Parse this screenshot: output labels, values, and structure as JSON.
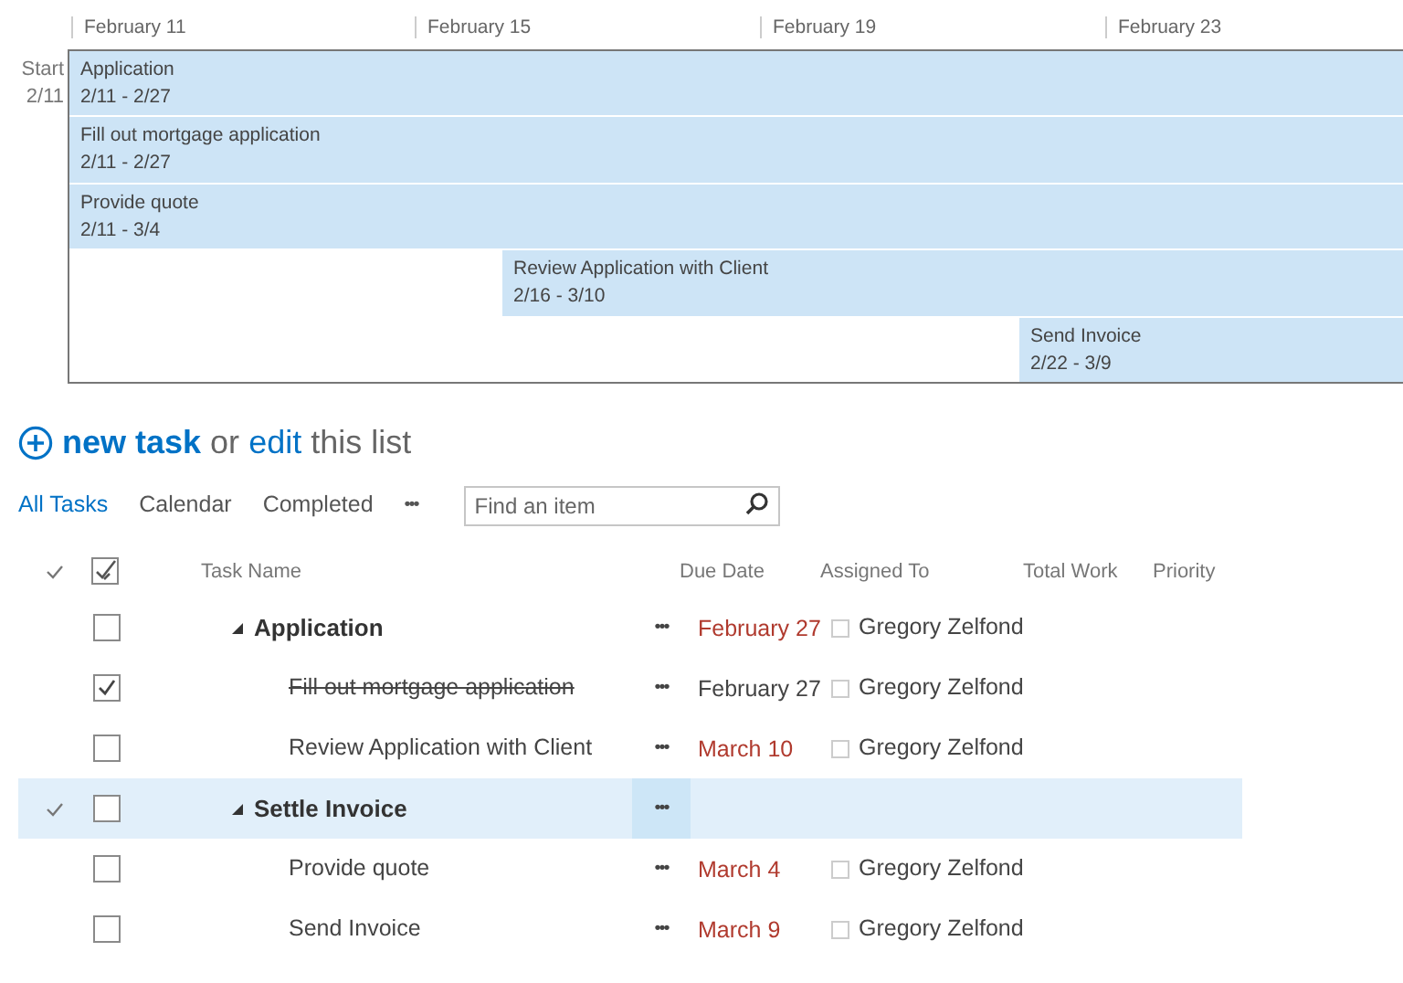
{
  "timeline": {
    "start_label": "Start",
    "start_date": "2/11",
    "ticks": [
      "February 11",
      "February 15",
      "February 19",
      "February 23"
    ],
    "bars": [
      {
        "name": "Application",
        "dates": "2/11 - 2/27"
      },
      {
        "name": "Fill out mortgage application",
        "dates": "2/11 - 2/27"
      },
      {
        "name": "Provide quote",
        "dates": "2/11 - 3/4"
      },
      {
        "name": "Review Application with Client",
        "dates": "2/16 - 3/10"
      },
      {
        "name": "Send Invoice",
        "dates": "2/22 - 3/9"
      }
    ]
  },
  "heading": {
    "new_task": "new task",
    "or": "or",
    "edit": "edit",
    "rest": "this list"
  },
  "views": [
    {
      "label": "All Tasks",
      "selected": true
    },
    {
      "label": "Calendar",
      "selected": false
    },
    {
      "label": "Completed",
      "selected": false
    }
  ],
  "more": "•••",
  "search": {
    "placeholder": "Find an item"
  },
  "select_all": {
    "checked": true
  },
  "columns": [
    "Task Name",
    "Due Date",
    "Assigned To",
    "Total Work",
    "Priority"
  ],
  "rows": [
    {
      "name": "Application",
      "selected": false,
      "checked": false,
      "expanded": true,
      "due": "February 27",
      "overdue": true,
      "assigned": "Gregory Zelfond",
      "children": [
        {
          "name": "Fill out mortgage application",
          "selected": false,
          "checked": true,
          "due": "February 27",
          "overdue": false,
          "assigned": "Gregory Zelfond"
        },
        {
          "name": "Review Application with Client",
          "selected": false,
          "checked": false,
          "due": "March 10",
          "overdue": true,
          "assigned": "Gregory Zelfond"
        }
      ]
    },
    {
      "name": "Settle Invoice",
      "selected": true,
      "checked": false,
      "expanded": true,
      "children": [
        {
          "name": "Provide quote",
          "selected": false,
          "checked": false,
          "due": "March 4",
          "overdue": true,
          "assigned": "Gregory Zelfond"
        },
        {
          "name": "Send Invoice",
          "selected": false,
          "checked": false,
          "due": "March 9",
          "overdue": true,
          "assigned": "Gregory Zelfond"
        }
      ]
    }
  ]
}
